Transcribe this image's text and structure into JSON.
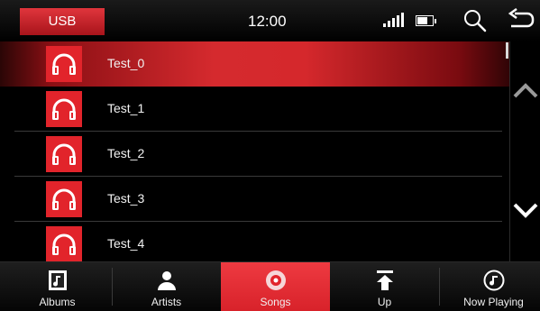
{
  "header": {
    "source_label": "USB",
    "time": "12:00",
    "battery_level": 0.7
  },
  "songs": [
    {
      "title": "Test_0",
      "selected": true
    },
    {
      "title": "Test_1",
      "selected": false
    },
    {
      "title": "Test_2",
      "selected": false
    },
    {
      "title": "Test_3",
      "selected": false
    },
    {
      "title": "Test_4",
      "selected": false
    }
  ],
  "tabs": [
    {
      "label": "Albums",
      "icon": "album-icon",
      "active": false
    },
    {
      "label": "Artists",
      "icon": "person-icon",
      "active": false
    },
    {
      "label": "Songs",
      "icon": "disc-icon",
      "active": true
    },
    {
      "label": "Up",
      "icon": "upload-icon",
      "active": false
    },
    {
      "label": "Now Playing",
      "icon": "music-note-icon",
      "active": false
    }
  ],
  "colors": {
    "accent": "#e2242b",
    "background": "#000000"
  }
}
